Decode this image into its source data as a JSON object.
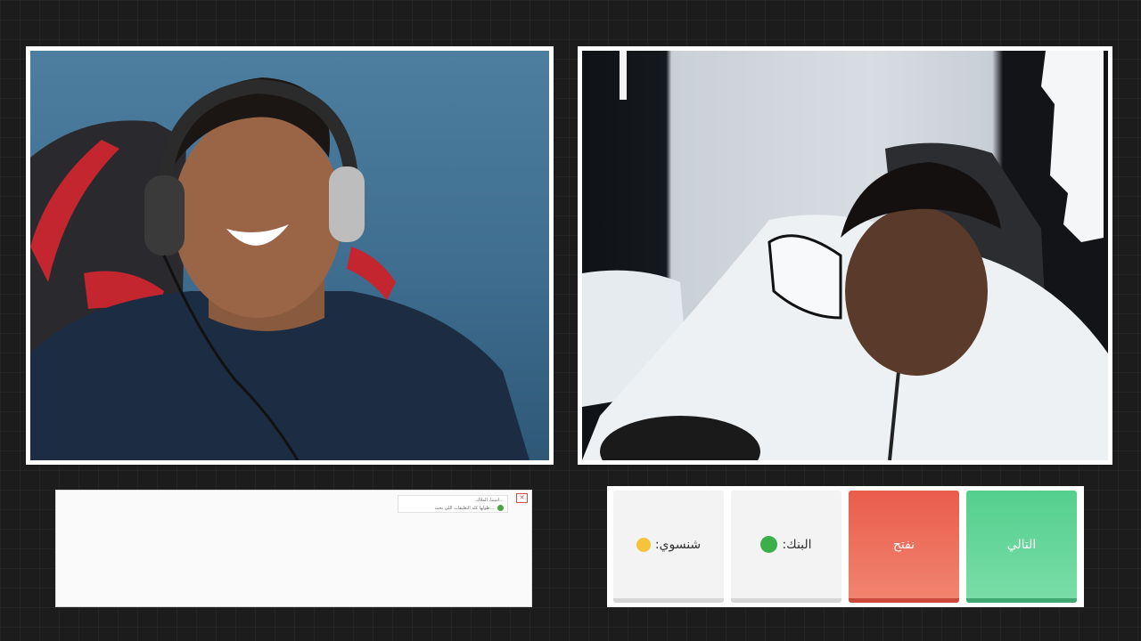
{
  "cams": {
    "left": {
      "alt": ""
    },
    "right": {
      "alt": ""
    }
  },
  "chat": {
    "close_icon": "close-icon",
    "message_line_1": "...استنا، الملاك",
    "message_line_2": "...طولها كله التعليقات اللي تحت",
    "badge_icon": "green-badge-icon"
  },
  "vote": {
    "options": [
      {
        "label": "شنسوي:",
        "icon": "emoji-face-icon"
      },
      {
        "label": "البنك:",
        "icon": "green-badge-icon"
      },
      {
        "label": "نفتح",
        "icon": ""
      },
      {
        "label": "التالي",
        "icon": ""
      }
    ],
    "colors": {
      "grey": "#f3f3f3",
      "red": "#ea5c4b",
      "green": "#54cf8d"
    }
  }
}
